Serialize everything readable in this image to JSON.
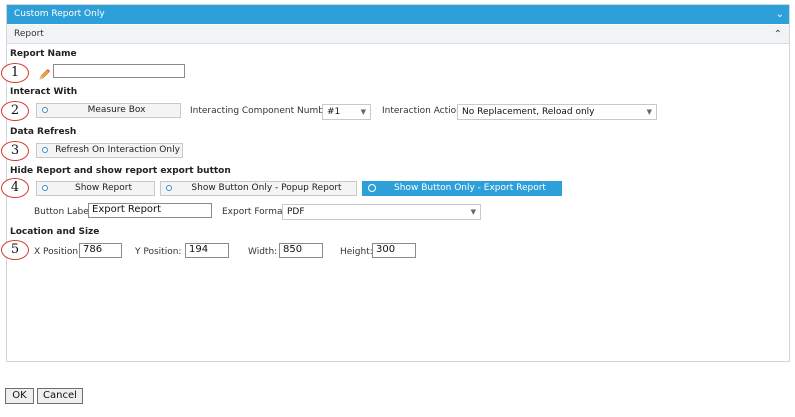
{
  "header": {
    "title": "Custom Report Only",
    "collapse_icon": "chevron-down-icon"
  },
  "subheader": {
    "title": "Report",
    "collapse_icon": "chevron-up-icon"
  },
  "sections": {
    "report_name": {
      "label": "Report Name",
      "step": "1",
      "icon": "pencil-icon",
      "value": ""
    },
    "interact_with": {
      "label": "Interact With",
      "step": "2",
      "measure_box_label": "Measure Box",
      "component_number_label": "Interacting Component Number:",
      "component_number_value": "#1",
      "interaction_action_label": "Interaction Action:",
      "interaction_action_value": "No Replacement, Reload only"
    },
    "data_refresh": {
      "label": "Data Refresh",
      "step": "3",
      "option_label": "Refresh On Interaction Only"
    },
    "hide_report": {
      "label": "Hide Report and show report export button",
      "step": "4",
      "options": [
        "Show Report",
        "Show Button Only - Popup Report",
        "Show Button Only - Export Report"
      ],
      "selected": "Show Button Only - Export Report",
      "button_label_label": "Button Label",
      "button_label_value": "Export Report",
      "export_format_label": "Export Format",
      "export_format_value": "PDF"
    },
    "location_size": {
      "label": "Location and Size",
      "step": "5",
      "x_label": "X Position:",
      "x_value": "786",
      "y_label": "Y Position:",
      "y_value": "194",
      "width_label": "Width:",
      "width_value": "850",
      "height_label": "Height:",
      "height_value": "300"
    }
  },
  "footer": {
    "ok_label": "OK",
    "cancel_label": "Cancel"
  },
  "colors": {
    "accent": "#2d9fd9",
    "step_circle": "#d43a2f"
  }
}
